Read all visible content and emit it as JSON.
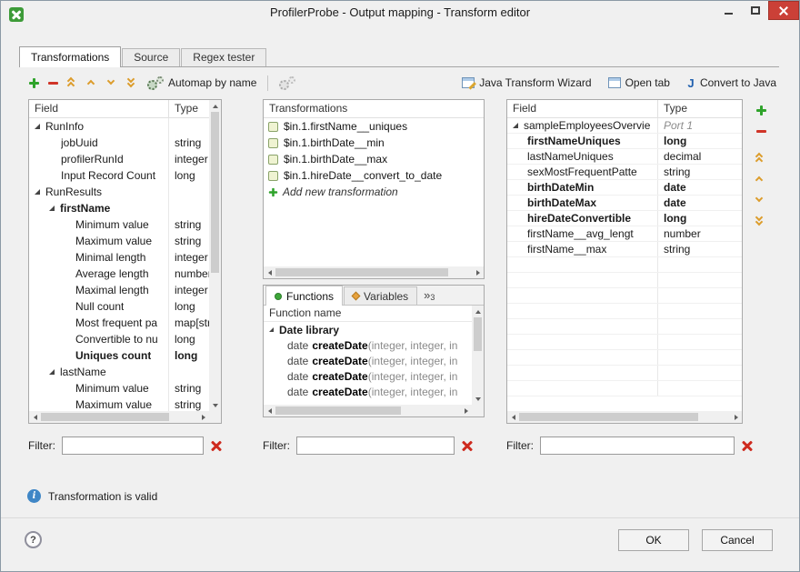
{
  "window": {
    "title": "ProfilerProbe - Output mapping - Transform editor"
  },
  "icons": {
    "info_letter": "i",
    "help_glyph": "?",
    "overflow_chevrons": "»",
    "java_letter": "J"
  },
  "tabs": [
    {
      "label": "Transformations",
      "active": true
    },
    {
      "label": "Source",
      "active": false
    },
    {
      "label": "Regex tester",
      "active": false
    }
  ],
  "toolbar": {
    "automap_label": "Automap by name",
    "java_wizard_label": "Java Transform Wizard",
    "open_tab_label": "Open tab",
    "convert_label": "Convert to Java"
  },
  "left_table": {
    "columns": [
      "Field",
      "Type"
    ],
    "filter": {
      "label": "Filter:",
      "value": ""
    },
    "rows": [
      {
        "label": "RunInfo",
        "type": "",
        "level": 0,
        "expandable": true
      },
      {
        "label": "jobUuid",
        "type": "string",
        "level": 1
      },
      {
        "label": "profilerRunId",
        "type": "integer",
        "level": 1
      },
      {
        "label": "Input Record Count",
        "type": "long",
        "level": 1
      },
      {
        "label": "RunResults",
        "type": "",
        "level": 0,
        "expandable": true
      },
      {
        "label": "firstName",
        "type": "",
        "level": 1,
        "expandable": true,
        "bold": true
      },
      {
        "label": "Minimum value",
        "type": "string",
        "level": 2
      },
      {
        "label": "Maximum value",
        "type": "string",
        "level": 2
      },
      {
        "label": "Minimal length",
        "type": "integer",
        "level": 2
      },
      {
        "label": "Average length",
        "type": "number",
        "level": 2
      },
      {
        "label": "Maximal length",
        "type": "integer",
        "level": 2
      },
      {
        "label": "Null count",
        "type": "long",
        "level": 2
      },
      {
        "label": "Most frequent pa",
        "type": "map[strin",
        "level": 2
      },
      {
        "label": "Convertible to nu",
        "type": "long",
        "level": 2
      },
      {
        "label": "Uniques count",
        "type": "long",
        "level": 2,
        "bold": true
      },
      {
        "label": "lastName",
        "type": "",
        "level": 1,
        "expandable": true
      },
      {
        "label": "Minimum value",
        "type": "string",
        "level": 2
      },
      {
        "label": "Maximum value",
        "type": "string",
        "level": 2
      }
    ]
  },
  "transformations": {
    "header": "Transformations",
    "items": [
      "$in.1.firstName__uniques",
      "$in.1.birthDate__min",
      "$in.1.birthDate__max",
      "$in.1.hireDate__convert_to_date"
    ],
    "add_label": "Add new transformation"
  },
  "functions": {
    "tabs": [
      "Functions",
      "Variables"
    ],
    "overflow_count": "3",
    "header": "Function name",
    "group": "Date library",
    "items": [
      {
        "ret": "date",
        "name": "createDate",
        "args": "(integer, integer, in"
      },
      {
        "ret": "date",
        "name": "createDate",
        "args": "(integer, integer, in"
      },
      {
        "ret": "date",
        "name": "createDate",
        "args": "(integer, integer, in"
      },
      {
        "ret": "date",
        "name": "createDate",
        "args": "(integer, integer, in"
      }
    ],
    "filter": {
      "label": "Filter:",
      "value": ""
    }
  },
  "right_table": {
    "columns": [
      "Field",
      "Type"
    ],
    "filter": {
      "label": "Filter:",
      "value": ""
    },
    "rows": [
      {
        "label": "sampleEmployeesOvervie",
        "type": "Port 1",
        "level": 0,
        "expandable": true,
        "port": true
      },
      {
        "label": "firstNameUniques",
        "type": "long",
        "level": 1,
        "bold": true
      },
      {
        "label": "lastNameUniques",
        "type": "decimal",
        "level": 1
      },
      {
        "label": "sexMostFrequentPatte",
        "type": "string",
        "level": 1
      },
      {
        "label": "birthDateMin",
        "type": "date",
        "level": 1,
        "bold": true
      },
      {
        "label": "birthDateMax",
        "type": "date",
        "level": 1,
        "bold": true
      },
      {
        "label": "hireDateConvertible",
        "type": "long",
        "level": 1,
        "bold": true
      },
      {
        "label": "firstName__avg_lengt",
        "type": "number",
        "level": 1
      },
      {
        "label": "firstName__max",
        "type": "string",
        "level": 1
      }
    ]
  },
  "status": {
    "message": "Transformation is valid"
  },
  "footer": {
    "ok_label": "OK",
    "cancel_label": "Cancel"
  }
}
